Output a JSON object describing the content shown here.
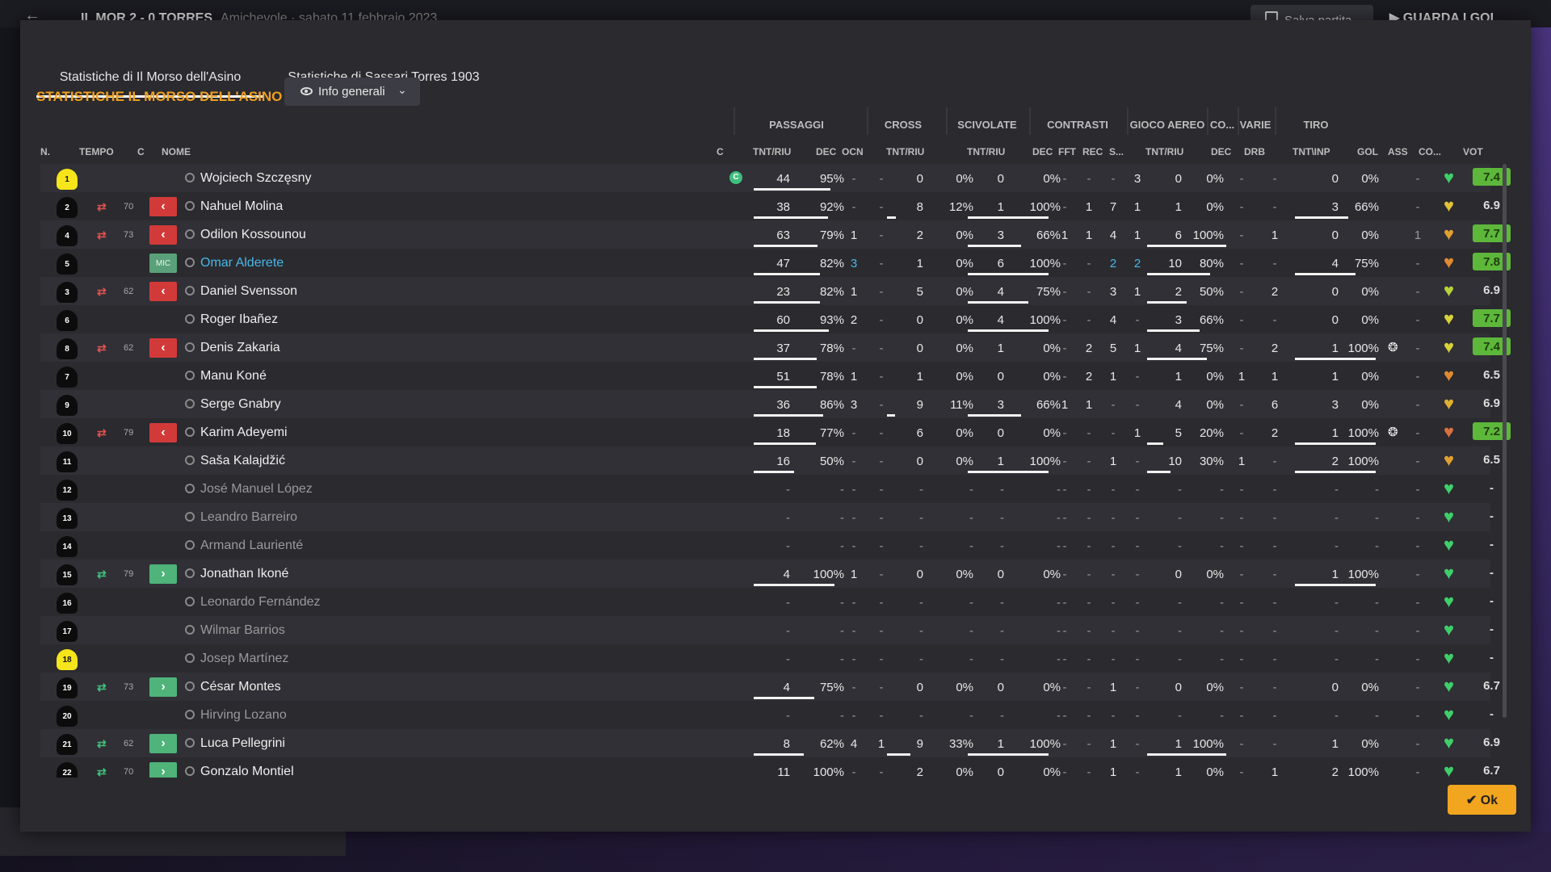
{
  "topbar": {
    "back_icon": "arrow-left-icon",
    "match": "IL MOR 2 - 0 TORRES",
    "context": "Amichevole · sabato 11 febbraio 2023",
    "save_label": "Salva partita",
    "watch_label": "GUARDA I GOL"
  },
  "tabs": [
    "Statistiche di Il Morso dell'Asino",
    "Statistiche di Sassari Torres 1903"
  ],
  "title": "STATISTICHE IL MORSO DELL'ASINO",
  "dropdown": {
    "label": "Info generali",
    "icon": "eye-icon"
  },
  "groups": [
    "PASSAGGI",
    "CROSS",
    "SCIVOLATE",
    "CONTRASTI",
    "GIOCO AEREO",
    "CO...",
    "VARIE",
    "TIRO"
  ],
  "columns": {
    "n": "N.",
    "tempo": "TEMPO",
    "c": "C",
    "nome": "NOME",
    "cap": "C",
    "pass_tr": "TNT/RIU",
    "pass_dec": "DEC",
    "pass_ocn": "OCN",
    "cross_tr": "TNT/RIU",
    "scivo_tr": "TNT/RIU",
    "con_dec": "DEC",
    "con_fft": "FFT",
    "con_rec": "REC",
    "con_s": "S...",
    "aereo_tr": "TNT/RIU",
    "co_dec": "DEC",
    "varie_drb": "DRB",
    "tiro_tr": "TNT\\INP",
    "gol": "GOL",
    "ass": "ASS",
    "co": "CO...",
    "vot": "VOT"
  },
  "players": [
    {
      "n": "1",
      "gk": true,
      "sub": "",
      "min": "",
      "c": "",
      "name": "Wojciech Szczęsny",
      "captain": true,
      "p": [
        "44",
        "95%"
      ],
      "pd": "-",
      "po": "-",
      "cr": [
        "0",
        "0%"
      ],
      "sc": [
        "0",
        "0%"
      ],
      "ct": [
        "-",
        "-",
        "-",
        "3"
      ],
      "ae": [
        "0",
        "0%"
      ],
      "cod": "-",
      "drb": "-",
      "ti": [
        "0",
        "0%"
      ],
      "gol": "",
      "ass": "-",
      "heart": "#3fcf6a",
      "vot": "7.4",
      "good": true
    },
    {
      "n": "2",
      "gk": false,
      "sub": "out",
      "min": "70",
      "c": "out",
      "name": "Nahuel Molina",
      "captain": false,
      "p": [
        "38",
        "92%"
      ],
      "pd": "-",
      "po": "-",
      "cr": [
        "8",
        "12%"
      ],
      "sc": [
        "1",
        "100%"
      ],
      "ct": [
        "-",
        "1",
        "7",
        "1"
      ],
      "ae": [
        "1",
        "0%"
      ],
      "cod": "-",
      "drb": "-",
      "ti": [
        "3",
        "66%"
      ],
      "gol": "",
      "ass": "-",
      "heart": "#e2c13a",
      "vot": "6.9",
      "good": false
    },
    {
      "n": "4",
      "gk": false,
      "sub": "out",
      "min": "73",
      "c": "out",
      "name": "Odilon Kossounou",
      "captain": false,
      "p": [
        "63",
        "79%"
      ],
      "pd": "1",
      "po": "-",
      "cr": [
        "2",
        "0%"
      ],
      "sc": [
        "3",
        "66%"
      ],
      "ct": [
        "1",
        "1",
        "4",
        "1"
      ],
      "ae": [
        "6",
        "100%"
      ],
      "cod": "-",
      "drb": "1",
      "ti": [
        "0",
        "0%"
      ],
      "gol": "",
      "ass": "1",
      "heart": "#e0a030",
      "vot": "7.7",
      "good": true
    },
    {
      "n": "5",
      "gk": false,
      "sub": "",
      "min": "",
      "c": "mic",
      "name": "Omar Alderete",
      "captain": false,
      "blue": true,
      "p": [
        "47",
        "82%"
      ],
      "pd": "3",
      "po": "-",
      "cr": [
        "1",
        "0%"
      ],
      "sc": [
        "6",
        "100%"
      ],
      "ct": [
        "-",
        "-",
        "2",
        "2"
      ],
      "ae": [
        "10",
        "80%"
      ],
      "cod": "-",
      "drb": "-",
      "ti": [
        "4",
        "75%"
      ],
      "gol": "",
      "ass": "-",
      "heart": "#e08a30",
      "vot": "7.8",
      "good": true
    },
    {
      "n": "3",
      "gk": false,
      "sub": "out",
      "min": "62",
      "c": "out",
      "name": "Daniel Svensson",
      "captain": false,
      "p": [
        "23",
        "82%"
      ],
      "pd": "1",
      "po": "-",
      "cr": [
        "5",
        "0%"
      ],
      "sc": [
        "4",
        "75%"
      ],
      "ct": [
        "-",
        "-",
        "3",
        "1"
      ],
      "ae": [
        "2",
        "50%"
      ],
      "cod": "-",
      "drb": "2",
      "ti": [
        "0",
        "0%"
      ],
      "gol": "",
      "ass": "-",
      "heart": "#b8d23a",
      "vot": "6.9",
      "good": false
    },
    {
      "n": "6",
      "gk": false,
      "sub": "",
      "min": "",
      "c": "",
      "name": "Roger Ibañez",
      "captain": false,
      "p": [
        "60",
        "93%"
      ],
      "pd": "2",
      "po": "-",
      "cr": [
        "0",
        "0%"
      ],
      "sc": [
        "4",
        "100%"
      ],
      "ct": [
        "-",
        "-",
        "4",
        "-"
      ],
      "ae": [
        "3",
        "66%"
      ],
      "cod": "-",
      "drb": "-",
      "ti": [
        "0",
        "0%"
      ],
      "gol": "",
      "ass": "-",
      "heart": "#d8d23a",
      "vot": "7.7",
      "good": true
    },
    {
      "n": "8",
      "gk": false,
      "sub": "out",
      "min": "62",
      "c": "out",
      "name": "Denis Zakaria",
      "captain": false,
      "p": [
        "37",
        "78%"
      ],
      "pd": "-",
      "po": "-",
      "cr": [
        "0",
        "0%"
      ],
      "sc": [
        "1",
        "0%"
      ],
      "ct": [
        "-",
        "2",
        "5",
        "1"
      ],
      "ae": [
        "4",
        "75%"
      ],
      "cod": "-",
      "drb": "2",
      "ti": [
        "1",
        "100%"
      ],
      "gol": "ball",
      "ass": "-",
      "heart": "#d8d23a",
      "vot": "7.4",
      "good": true
    },
    {
      "n": "7",
      "gk": false,
      "sub": "",
      "min": "",
      "c": "",
      "name": "Manu Koné",
      "captain": false,
      "p": [
        "51",
        "78%"
      ],
      "pd": "1",
      "po": "-",
      "cr": [
        "1",
        "0%"
      ],
      "sc": [
        "0",
        "0%"
      ],
      "ct": [
        "-",
        "2",
        "1",
        "-"
      ],
      "ae": [
        "1",
        "0%"
      ],
      "cod": "1",
      "drb": "1",
      "ti": [
        "1",
        "0%"
      ],
      "gol": "",
      "ass": "-",
      "heart": "#e08a30",
      "vot": "6.5",
      "good": false
    },
    {
      "n": "9",
      "gk": false,
      "sub": "",
      "min": "",
      "c": "",
      "name": "Serge Gnabry",
      "captain": false,
      "p": [
        "36",
        "86%"
      ],
      "pd": "3",
      "po": "-",
      "cr": [
        "9",
        "11%"
      ],
      "sc": [
        "3",
        "66%"
      ],
      "ct": [
        "1",
        "1",
        "-",
        "-"
      ],
      "ae": [
        "4",
        "0%"
      ],
      "cod": "-",
      "drb": "6",
      "ti": [
        "3",
        "0%"
      ],
      "gol": "",
      "ass": "-",
      "heart": "#e0b030",
      "vot": "6.9",
      "good": false
    },
    {
      "n": "10",
      "gk": false,
      "sub": "out",
      "min": "79",
      "c": "out",
      "name": "Karim Adeyemi",
      "captain": false,
      "p": [
        "18",
        "77%"
      ],
      "pd": "-",
      "po": "-",
      "cr": [
        "6",
        "0%"
      ],
      "sc": [
        "0",
        "0%"
      ],
      "ct": [
        "-",
        "-",
        "-",
        "1"
      ],
      "ae": [
        "5",
        "20%"
      ],
      "cod": "-",
      "drb": "2",
      "ti": [
        "1",
        "100%"
      ],
      "gol": "ball",
      "ass": "-",
      "heart": "#d87040",
      "vot": "7.2",
      "good": true
    },
    {
      "n": "11",
      "gk": false,
      "sub": "",
      "min": "",
      "c": "",
      "name": "Saša Kalajdžić",
      "captain": false,
      "p": [
        "16",
        "50%"
      ],
      "pd": "-",
      "po": "-",
      "cr": [
        "0",
        "0%"
      ],
      "sc": [
        "1",
        "100%"
      ],
      "ct": [
        "-",
        "-",
        "1",
        "-"
      ],
      "ae": [
        "10",
        "30%"
      ],
      "cod": "1",
      "drb": "-",
      "ti": [
        "2",
        "100%"
      ],
      "gol": "",
      "ass": "-",
      "heart": "#e0a030",
      "vot": "6.5",
      "good": false
    },
    {
      "n": "12",
      "gk": false,
      "sub": "",
      "min": "",
      "c": "",
      "name": "José Manuel López",
      "captain": false,
      "dim": true,
      "p": [
        "-",
        "-"
      ],
      "pd": "-",
      "po": "-",
      "cr": [
        "-",
        "-"
      ],
      "sc": [
        "-",
        "-"
      ],
      "ct": [
        "-",
        "-",
        "-",
        "-"
      ],
      "ae": [
        "-",
        "-"
      ],
      "cod": "-",
      "drb": "-",
      "ti": [
        "-",
        "-"
      ],
      "gol": "",
      "ass": "-",
      "heart": "#3fcf6a",
      "vot": "-",
      "good": false
    },
    {
      "n": "13",
      "gk": false,
      "sub": "",
      "min": "",
      "c": "",
      "name": "Leandro Barreiro",
      "captain": false,
      "dim": true,
      "p": [
        "-",
        "-"
      ],
      "pd": "-",
      "po": "-",
      "cr": [
        "-",
        "-"
      ],
      "sc": [
        "-",
        "-"
      ],
      "ct": [
        "-",
        "-",
        "-",
        "-"
      ],
      "ae": [
        "-",
        "-"
      ],
      "cod": "-",
      "drb": "-",
      "ti": [
        "-",
        "-"
      ],
      "gol": "",
      "ass": "-",
      "heart": "#3fcf6a",
      "vot": "-",
      "good": false
    },
    {
      "n": "14",
      "gk": false,
      "sub": "",
      "min": "",
      "c": "",
      "name": "Armand Laurienté",
      "captain": false,
      "dim": true,
      "p": [
        "-",
        "-"
      ],
      "pd": "-",
      "po": "-",
      "cr": [
        "-",
        "-"
      ],
      "sc": [
        "-",
        "-"
      ],
      "ct": [
        "-",
        "-",
        "-",
        "-"
      ],
      "ae": [
        "-",
        "-"
      ],
      "cod": "-",
      "drb": "-",
      "ti": [
        "-",
        "-"
      ],
      "gol": "",
      "ass": "-",
      "heart": "#3fcf6a",
      "vot": "-",
      "good": false
    },
    {
      "n": "15",
      "gk": false,
      "sub": "in",
      "min": "79",
      "c": "in",
      "name": "Jonathan Ikoné",
      "captain": false,
      "p": [
        "4",
        "100%"
      ],
      "pd": "1",
      "po": "-",
      "cr": [
        "0",
        "0%"
      ],
      "sc": [
        "0",
        "0%"
      ],
      "ct": [
        "-",
        "-",
        "-",
        "-"
      ],
      "ae": [
        "0",
        "0%"
      ],
      "cod": "-",
      "drb": "-",
      "ti": [
        "1",
        "100%"
      ],
      "gol": "",
      "ass": "-",
      "heart": "#3fcf6a",
      "vot": "-",
      "good": false
    },
    {
      "n": "16",
      "gk": false,
      "sub": "",
      "min": "",
      "c": "",
      "name": "Leonardo Fernández",
      "captain": false,
      "dim": true,
      "p": [
        "-",
        "-"
      ],
      "pd": "-",
      "po": "-",
      "cr": [
        "-",
        "-"
      ],
      "sc": [
        "-",
        "-"
      ],
      "ct": [
        "-",
        "-",
        "-",
        "-"
      ],
      "ae": [
        "-",
        "-"
      ],
      "cod": "-",
      "drb": "-",
      "ti": [
        "-",
        "-"
      ],
      "gol": "",
      "ass": "-",
      "heart": "#3fcf6a",
      "vot": "-",
      "good": false
    },
    {
      "n": "17",
      "gk": false,
      "sub": "",
      "min": "",
      "c": "",
      "name": "Wilmar Barrios",
      "captain": false,
      "dim": true,
      "p": [
        "-",
        "-"
      ],
      "pd": "-",
      "po": "-",
      "cr": [
        "-",
        "-"
      ],
      "sc": [
        "-",
        "-"
      ],
      "ct": [
        "-",
        "-",
        "-",
        "-"
      ],
      "ae": [
        "-",
        "-"
      ],
      "cod": "-",
      "drb": "-",
      "ti": [
        "-",
        "-"
      ],
      "gol": "",
      "ass": "-",
      "heart": "#3fcf6a",
      "vot": "-",
      "good": false
    },
    {
      "n": "18",
      "gk": true,
      "sub": "",
      "min": "",
      "c": "",
      "name": "Josep Martínez",
      "captain": false,
      "dim": true,
      "p": [
        "-",
        "-"
      ],
      "pd": "-",
      "po": "-",
      "cr": [
        "-",
        "-"
      ],
      "sc": [
        "-",
        "-"
      ],
      "ct": [
        "-",
        "-",
        "-",
        "-"
      ],
      "ae": [
        "-",
        "-"
      ],
      "cod": "-",
      "drb": "-",
      "ti": [
        "-",
        "-"
      ],
      "gol": "",
      "ass": "-",
      "heart": "#3fcf6a",
      "vot": "-",
      "good": false
    },
    {
      "n": "19",
      "gk": false,
      "sub": "in",
      "min": "73",
      "c": "in",
      "name": "César Montes",
      "captain": false,
      "p": [
        "4",
        "75%"
      ],
      "pd": "-",
      "po": "-",
      "cr": [
        "0",
        "0%"
      ],
      "sc": [
        "0",
        "0%"
      ],
      "ct": [
        "-",
        "-",
        "1",
        "-"
      ],
      "ae": [
        "0",
        "0%"
      ],
      "cod": "-",
      "drb": "-",
      "ti": [
        "0",
        "0%"
      ],
      "gol": "",
      "ass": "-",
      "heart": "#3fcf6a",
      "vot": "6.7",
      "good": false
    },
    {
      "n": "20",
      "gk": false,
      "sub": "",
      "min": "",
      "c": "",
      "name": "Hirving Lozano",
      "captain": false,
      "dim": true,
      "p": [
        "-",
        "-"
      ],
      "pd": "-",
      "po": "-",
      "cr": [
        "-",
        "-"
      ],
      "sc": [
        "-",
        "-"
      ],
      "ct": [
        "-",
        "-",
        "-",
        "-"
      ],
      "ae": [
        "-",
        "-"
      ],
      "cod": "-",
      "drb": "-",
      "ti": [
        "-",
        "-"
      ],
      "gol": "",
      "ass": "-",
      "heart": "#3fcf6a",
      "vot": "-",
      "good": false
    },
    {
      "n": "21",
      "gk": false,
      "sub": "in",
      "min": "62",
      "c": "in",
      "name": "Luca Pellegrini",
      "captain": false,
      "p": [
        "8",
        "62%"
      ],
      "pd": "4",
      "po": "1",
      "cr": [
        "9",
        "33%"
      ],
      "sc": [
        "1",
        "100%"
      ],
      "ct": [
        "-",
        "-",
        "1",
        "-"
      ],
      "ae": [
        "1",
        "100%"
      ],
      "cod": "-",
      "drb": "-",
      "ti": [
        "1",
        "0%"
      ],
      "gol": "",
      "ass": "-",
      "heart": "#3fcf6a",
      "vot": "6.9",
      "good": false
    },
    {
      "n": "22",
      "gk": false,
      "sub": "in",
      "min": "70",
      "c": "in",
      "name": "Gonzalo Montiel",
      "captain": false,
      "p": [
        "11",
        "100%"
      ],
      "pd": "-",
      "po": "-",
      "cr": [
        "2",
        "0%"
      ],
      "sc": [
        "0",
        "0%"
      ],
      "ct": [
        "-",
        "-",
        "1",
        "-"
      ],
      "ae": [
        "1",
        "0%"
      ],
      "cod": "-",
      "drb": "1",
      "ti": [
        "2",
        "100%"
      ],
      "gol": "",
      "ass": "-",
      "heart": "#3fcf6a",
      "vot": "6.7",
      "good": false
    }
  ],
  "ok_label": "Ok",
  "colors": {
    "accent": "#f0a020",
    "rating_good": "#5db73a",
    "sub_out": "#d23a3a",
    "sub_in": "#4fb37a"
  }
}
